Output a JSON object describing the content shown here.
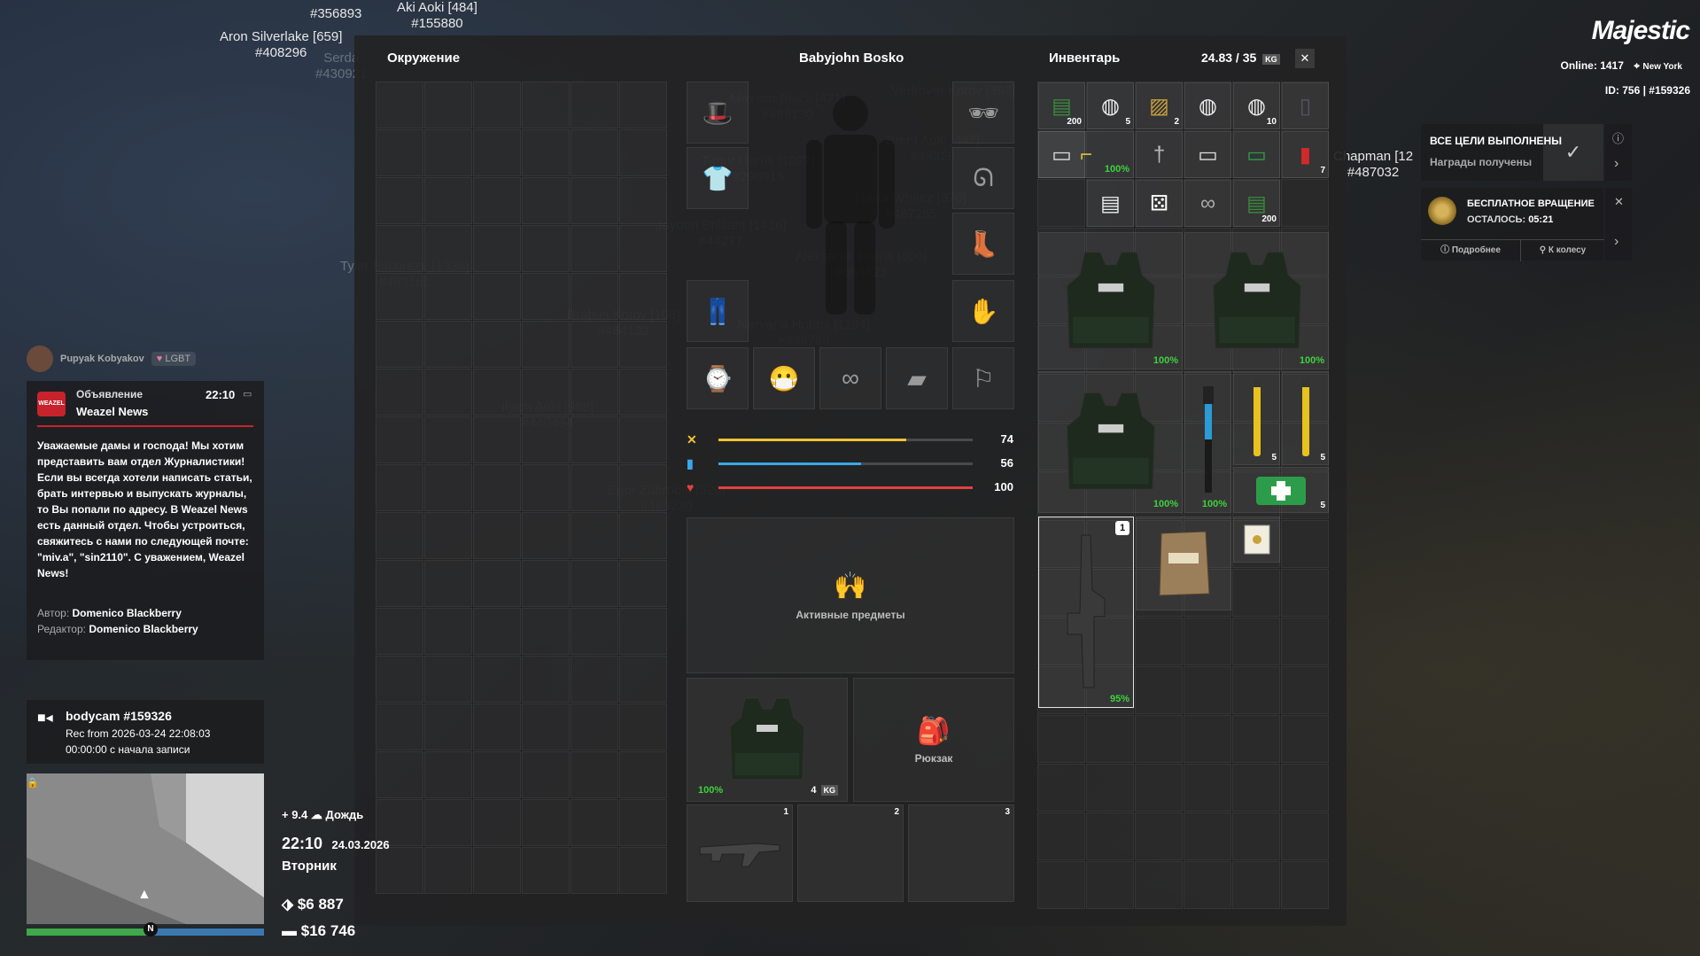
{
  "overhead_names": [
    {
      "name": "Aki Aoki [484]",
      "id": "#155880",
      "bright": true
    },
    {
      "name": "Aron Silverlake [659]",
      "id": "#408296",
      "bright": true
    },
    {
      "name": "#356893",
      "id": "",
      "bright": true
    },
    {
      "name": "Serda",
      "id": "#430921",
      "bright": false
    },
    {
      "name": "Maxsim Black [471]",
      "id": "#486130",
      "bright": false
    },
    {
      "name": "Vedrover Kotov [392]",
      "id": "",
      "bright": false
    },
    {
      "name": "Brent Aoki [447]",
      "id": "#48328",
      "bright": false
    },
    {
      "name": "Timur Harris [1027]",
      "id": "#298915",
      "bright": false
    },
    {
      "name": "Nikita Whitez [870]",
      "id": "#487285",
      "bright": false
    },
    {
      "name": "Jayden Brilliant [1416]",
      "id": "#44277",
      "bright": false
    },
    {
      "name": "Aleksandr Harris [806]",
      "id": "#384423",
      "bright": false
    },
    {
      "name": "Tyler Escoreze [1336]",
      "id": "#483161",
      "bright": false
    },
    {
      "name": "Brabus Kotov [108]",
      "id": "#484132",
      "bright": false
    },
    {
      "name": "Nervana Hobbs [1194]",
      "id": "#439799",
      "bright": false
    },
    {
      "name": "Ilyich Aoki [988]",
      "id": "#440494",
      "bright": false
    },
    {
      "name": "Egor Zabrodin [526]",
      "id": "#485230",
      "bright": false
    },
    {
      "name": "Chapman [12",
      "id": "#487032",
      "bright": true
    }
  ],
  "logo": "Majestic",
  "server": {
    "online_label": "Online:",
    "online_count": "1417",
    "city": "New York",
    "id_line": "ID: 756 | #159326"
  },
  "surroundings": {
    "title": "Окружение"
  },
  "character": {
    "name": "Babyjohn Bosko"
  },
  "stats": [
    {
      "name": "hunger",
      "value": 74,
      "color": "#f2c230",
      "icon": "✕"
    },
    {
      "name": "thirst",
      "value": 56,
      "color": "#39a8e8",
      "icon": "▮"
    },
    {
      "name": "health",
      "value": 100,
      "color": "#e24040",
      "icon": "♥"
    }
  ],
  "active_items": {
    "label": "Активные предметы"
  },
  "backpack": {
    "label": "Рюкзак"
  },
  "equipped_vest": {
    "durability": "100%",
    "weight": "4",
    "weight_unit": "KG"
  },
  "hotbar": {
    "slots": [
      "1",
      "2",
      "3"
    ]
  },
  "inventory": {
    "title": "Инвентарь",
    "weight": "24.83 / 35",
    "weight_unit": "KG",
    "close": "✕",
    "small_items": [
      {
        "name": "cash-stack",
        "count": "200"
      },
      {
        "name": "toilet-paper",
        "count": "5"
      },
      {
        "name": "cigar-box",
        "count": "2"
      },
      {
        "name": "toilet-paper",
        "count": ""
      },
      {
        "name": "toilet-paper",
        "count": "10"
      },
      {
        "name": "phone",
        "count": ""
      },
      {
        "name": "pistol",
        "count": "100%"
      },
      {
        "name": "knife",
        "count": ""
      },
      {
        "name": "id-card",
        "count": ""
      },
      {
        "name": "green-card",
        "count": ""
      },
      {
        "name": "red-pack",
        "count": "7"
      },
      {
        "name": "license-card",
        "count": ""
      },
      {
        "name": "document",
        "count": ""
      },
      {
        "name": "dice",
        "count": ""
      },
      {
        "name": "binoculars",
        "count": ""
      },
      {
        "name": "cash-stack",
        "count": "200"
      }
    ],
    "vest_durability": [
      "100%",
      "100%",
      "100%"
    ],
    "flashlight_durability": "100%",
    "flare_counts": [
      "5",
      "5"
    ],
    "medkit_count": "5",
    "rifle": {
      "slot": "1",
      "durability": "95%"
    }
  },
  "goals": {
    "title": "ВСЕ ЦЕЛИ ВЫПОЛНЕНЫ",
    "subtitle": "Награды получены"
  },
  "spin": {
    "title": "БЕСПЛАТНОЕ ВРАЩЕНИЕ",
    "left_label": "ОСТАЛОСЬ:",
    "left_time": "05:21",
    "more": "Подробнее",
    "wheel": "К колесу"
  },
  "chat": {
    "user": "Pupyak Kobyakov",
    "tag": "LGBT"
  },
  "news": {
    "label": "Объявление",
    "time": "22:10",
    "source": "Weazel News",
    "body": "Уважаемые дамы и господа! Мы хотим представить вам отдел Журналистики! Если вы всегда хотели написать статьи, брать интервью и выпускать журналы, то Вы попали по адресу. В Weazel News есть данный отдел. Чтобы устроиться, свяжитесь с нами по следующей почте: \"miv.a\", \"sin2110\". С уважением, Weazel News!",
    "author_label": "Автор:",
    "author": "Domenico Blackberry",
    "editor_label": "Редактор:",
    "editor": "Domenico Blackberry"
  },
  "bodycam": {
    "title": "bodycam #159326",
    "rec": "Rec from 2026-03-24 22:08:03",
    "elapsed": "00:00:00 с начала записи"
  },
  "hud": {
    "temp": "+ 9.4",
    "weather": "Дождь",
    "time": "22:10",
    "date": "24.03.2026",
    "day": "Вторник",
    "cash": "$6 887",
    "bank": "$16 746"
  }
}
